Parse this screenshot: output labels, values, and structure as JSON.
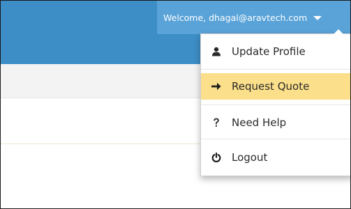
{
  "header": {
    "user_menu_label": "Welcome, dhagal@aravtech.com",
    "caret_icon": "caret-down-icon",
    "background_color": "#3d8ec6",
    "user_menu_color": "#5aa3d8"
  },
  "dropdown": {
    "items": [
      {
        "label": "Update Profile",
        "icon": "user-icon",
        "active": false
      },
      {
        "label": "Request Quote",
        "icon": "arrow-right-icon",
        "active": true
      },
      {
        "label": "Need Help",
        "icon": "question-icon",
        "active": false
      },
      {
        "label": "Logout",
        "icon": "power-icon",
        "active": false
      }
    ],
    "active_color": "#fbdf8a"
  }
}
